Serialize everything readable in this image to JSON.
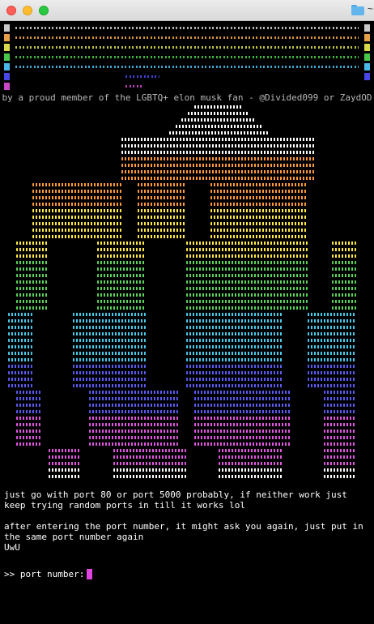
{
  "window": {
    "title_icon": "folder-icon",
    "title_text": "~"
  },
  "banner": {
    "row_colors": [
      "#c8c8c8",
      "#e8a048",
      "#d8d848",
      "#48c848",
      "#48b8e8",
      "#4848e8",
      "#c848c8"
    ],
    "subtitle": "by a proud member of the LGBTQ+ elon musk fan - @Divided099 or ZaydOD"
  },
  "art": {
    "colors": [
      "#ffffff",
      "#ff9a3c",
      "#ffe94a",
      "#5bd35b",
      "#49c9ea",
      "#5a5af0",
      "#e056e0"
    ]
  },
  "messages": {
    "line1": "just go with port 80 or port 5000 probably, if neither work just",
    "line2": "keep trying random ports in till it works lol",
    "line3": "after entering the port number, it might ask you again, just put in",
    "line4": "the same port number again",
    "line5": "UwU"
  },
  "prompt": {
    "text": ">> port number:"
  }
}
